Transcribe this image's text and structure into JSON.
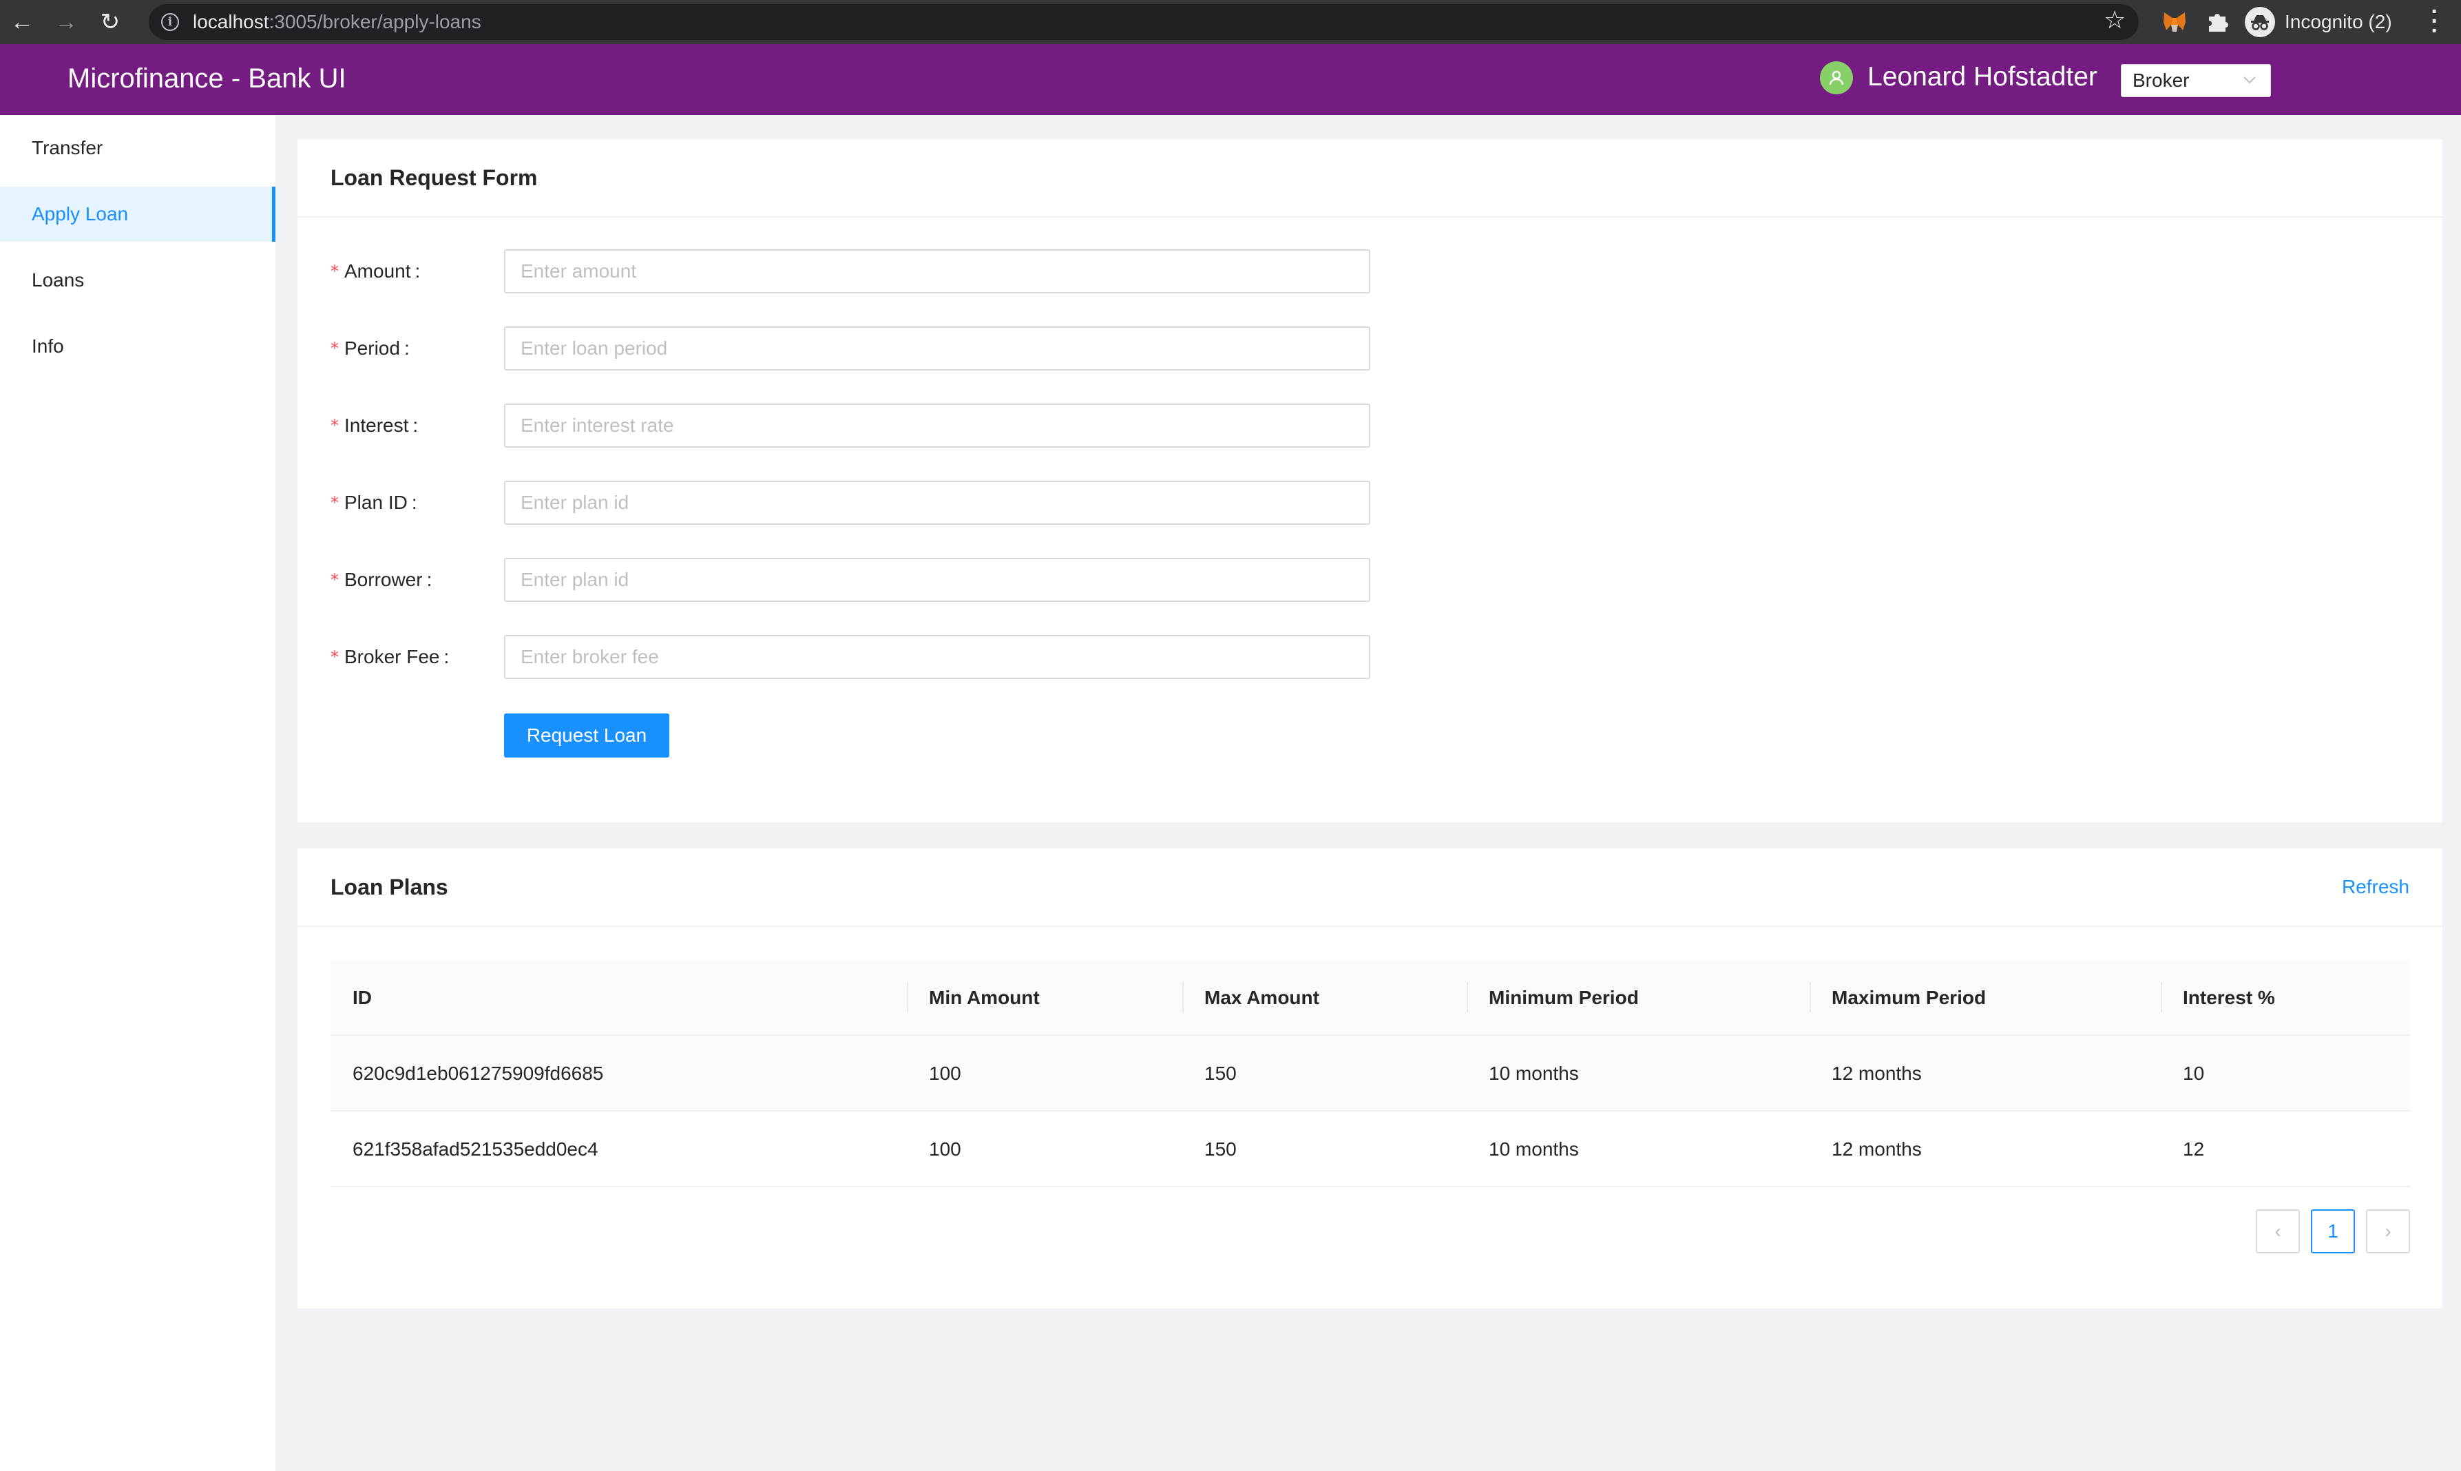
{
  "browser": {
    "url_host": "localhost",
    "url_rest": ":3005/broker/apply-loans",
    "incognito_label": "Incognito (2)"
  },
  "header": {
    "title": "Microfinance - Bank UI",
    "user_name": "Leonard Hofstadter",
    "role": "Broker"
  },
  "sidebar": {
    "items": [
      {
        "label": "Transfer",
        "active": false
      },
      {
        "label": "Apply Loan",
        "active": true
      },
      {
        "label": "Loans",
        "active": false
      },
      {
        "label": "Info",
        "active": false
      }
    ]
  },
  "form": {
    "title": "Loan Request Form",
    "fields": [
      {
        "label": "Amount",
        "placeholder": "Enter amount",
        "value": ""
      },
      {
        "label": "Period",
        "placeholder": "Enter loan period",
        "value": ""
      },
      {
        "label": "Interest",
        "placeholder": "Enter interest rate",
        "value": ""
      },
      {
        "label": "Plan ID",
        "placeholder": "Enter plan id",
        "value": ""
      },
      {
        "label": "Borrower",
        "placeholder": "Enter plan id",
        "value": ""
      },
      {
        "label": "Broker Fee",
        "placeholder": "Enter broker fee",
        "value": ""
      }
    ],
    "submit_label": "Request Loan"
  },
  "plans": {
    "title": "Loan Plans",
    "refresh_label": "Refresh",
    "columns": [
      "ID",
      "Min Amount",
      "Max Amount",
      "Minimum Period",
      "Maximum Period",
      "Interest %"
    ],
    "rows": [
      [
        "620c9d1eb061275909fd6685",
        "100",
        "150",
        "10 months",
        "12 months",
        "10"
      ],
      [
        "621f358afad521535edd0ec4",
        "100",
        "150",
        "10 months",
        "12 months",
        "12"
      ]
    ],
    "pagination": {
      "current": "1",
      "prev": "‹",
      "next": "›"
    }
  },
  "colors": {
    "header_bg": "#751c82",
    "primary": "#1890ff",
    "required": "#ff4d4f",
    "avatar": "#87d068"
  }
}
